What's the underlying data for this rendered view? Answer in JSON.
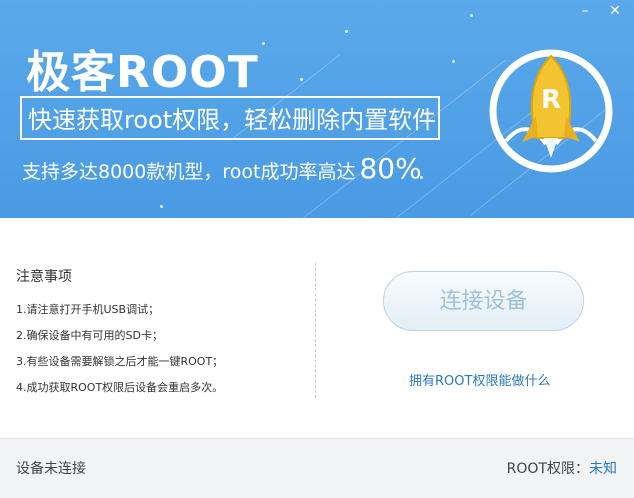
{
  "window": {
    "minimize_glyph": "–",
    "close_glyph": "✕"
  },
  "banner": {
    "title": "极客ROOT",
    "slogan": "快速获取root权限，轻松删除内置软件",
    "subline_text": "支持多达8000款机型，root成功率高达",
    "subline_percent": "80%",
    "logo_letter": "R",
    "colors": {
      "background": "#4a9ae4",
      "rocket": "#f4c430",
      "text": "#ffffff"
    }
  },
  "notes": {
    "title": "注意事项",
    "items": [
      "1.请注意打开手机USB调试；",
      "2.确保设备中有可用的SD卡；",
      "3.有些设备需要解锁之后才能一键ROOT；",
      "4.成功获取ROOT权限后设备会重启多次。"
    ]
  },
  "actions": {
    "connect_label": "连接设备",
    "info_link": "拥有ROOT权限能做什么"
  },
  "status": {
    "device_text": "设备未连接",
    "root_label": "ROOT权限：",
    "root_value": "未知"
  }
}
